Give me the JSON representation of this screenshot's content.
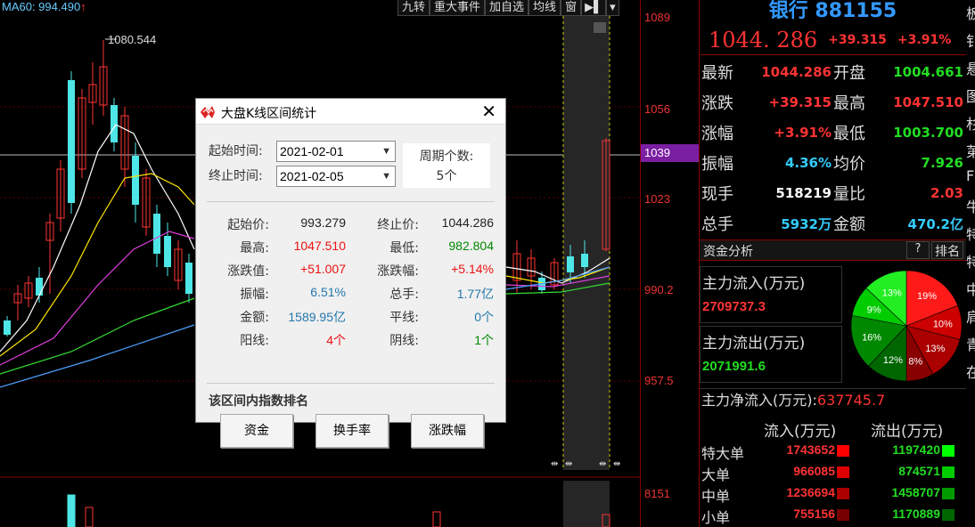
{
  "chart": {
    "ma60_label": "MA60: 994.490",
    "ma60_arrow": "↑",
    "peak_label": "1080.544",
    "tools": [
      "九转",
      "重大事件",
      "加自选",
      "均线",
      "窗"
    ],
    "price_axis": [
      "1089",
      "1056",
      "1023",
      "990.2",
      "957.5",
      "8151"
    ],
    "current_price_tag": "1039"
  },
  "quote": {
    "title": "银行 881155",
    "price": "1044. 286",
    "change": "+39.315",
    "change_pct": "+3.91%",
    "rows": [
      {
        "l1": "最新",
        "v1": "1044.286",
        "c1": "red",
        "l2": "开盘",
        "v2": "1004.661",
        "c2": "green"
      },
      {
        "l1": "涨跌",
        "v1": "+39.315",
        "c1": "red",
        "l2": "最高",
        "v2": "1047.510",
        "c2": "red"
      },
      {
        "l1": "涨幅",
        "v1": "+3.91%",
        "c1": "red",
        "l2": "最低",
        "v2": "1003.700",
        "c2": "green"
      },
      {
        "l1": "振幅",
        "v1": "4.36%",
        "c1": "cyan",
        "l2": "均价",
        "v2": "7.926",
        "c2": "green"
      },
      {
        "l1": "现手",
        "v1": "518219",
        "c1": "white",
        "l2": "量比",
        "v2": "2.03",
        "c2": "red"
      },
      {
        "l1": "总手",
        "v1": "5932万",
        "c1": "cyan",
        "l2": "金额",
        "v2": "470.2亿",
        "c2": "cyan"
      }
    ]
  },
  "fund": {
    "title": "资金分析",
    "help": "?",
    "rank": "排名",
    "inflow_label": "主力流入(万元)",
    "inflow_value": "2709737.3",
    "outflow_label": "主力流出(万元)",
    "outflow_value": "2071991.6",
    "net_label": "主力净流入(万元):",
    "net_value": "637745.7",
    "pie": [
      "19%",
      "10%",
      "13%",
      "8%",
      "12%",
      "16%",
      "9%",
      "13%"
    ],
    "flow_header_in": "流入(万元)",
    "flow_header_out": "流出(万元)",
    "flows": [
      {
        "label": "特大单",
        "in": "1743652",
        "out": "1197420"
      },
      {
        "label": "大单",
        "in": "966085",
        "out": "874571"
      },
      {
        "label": "中单",
        "in": "1236694",
        "out": "1458707"
      },
      {
        "label": "小单",
        "in": "755156",
        "out": "1170889"
      }
    ]
  },
  "edge_chars": [
    "板",
    "钅",
    "悬",
    "图",
    "杉",
    "苐",
    "F",
    "牛",
    "特",
    "特",
    "中",
    "肩",
    "青",
    "在"
  ],
  "dialog": {
    "title": "大盘K线区间统计",
    "start_label": "起始时间:",
    "start_value": "2021-02-01",
    "end_label": "终止时间:",
    "end_value": "2021-02-05",
    "period_label": "周期个数:",
    "period_value": "5个",
    "stats": [
      {
        "l1": "起始价:",
        "v1": "993.279",
        "c1": "black",
        "l2": "终止价:",
        "v2": "1044.286",
        "c2": "black"
      },
      {
        "l1": "最高:",
        "v1": "1047.510",
        "c1": "red",
        "l2": "最低:",
        "v2": "982.804",
        "c2": "green"
      },
      {
        "l1": "涨跌值:",
        "v1": "+51.007",
        "c1": "red",
        "l2": "涨跌幅:",
        "v2": "+5.14%",
        "c2": "red"
      },
      {
        "l1": "振幅:",
        "v1": "6.51%",
        "c1": "blue",
        "l2": "总手:",
        "v2": "1.77亿",
        "c2": "blue"
      },
      {
        "l1": "金额:",
        "v1": "1589.95亿",
        "c1": "blue",
        "l2": "平线:",
        "v2": "0个",
        "c2": "blue"
      },
      {
        "l1": "阳线:",
        "v1": "4个",
        "c1": "red",
        "l2": "阴线:",
        "v2": "1个",
        "c2": "green"
      }
    ],
    "rank_title": "该区间内指数排名",
    "buttons": [
      "资金",
      "换手率",
      "涨跌幅"
    ]
  }
}
